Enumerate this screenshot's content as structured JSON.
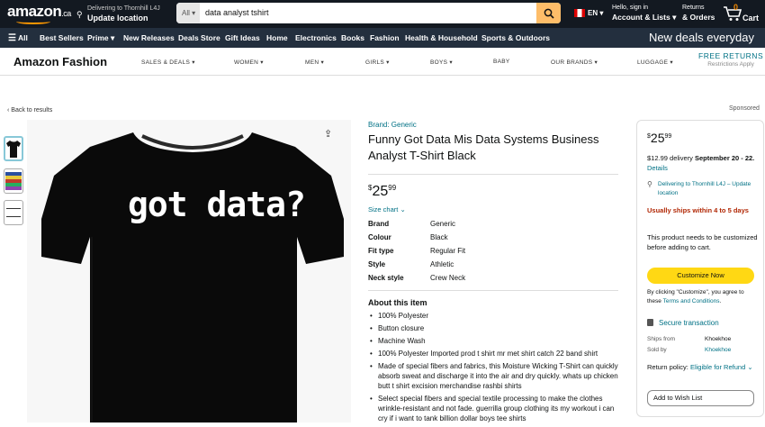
{
  "header": {
    "logo": "amazon",
    "logo_tld": ".ca",
    "deliver_line1": "Delivering to Thornhill L4J",
    "deliver_line2": "Update location",
    "search_category": "All",
    "search_value": "data analyst tshirt",
    "language": "EN",
    "account_line1": "Hello, sign in",
    "account_line2": "Account & Lists",
    "returns_line1": "Returns",
    "returns_line2": "& Orders",
    "cart_count": "0",
    "cart_label": "Cart"
  },
  "nav": {
    "all": "All",
    "items": [
      "Best Sellers",
      "Prime",
      "New Releases",
      "Deals Store",
      "Gift Ideas",
      "Home",
      "Electronics",
      "Books",
      "Fashion",
      "Health & Household",
      "Sports & Outdoors"
    ],
    "promo": "New deals everyday"
  },
  "fashion": {
    "title": "Amazon Fashion",
    "items": [
      "SALES & DEALS",
      "WOMEN",
      "MEN",
      "GIRLS",
      "BOYS",
      "BABY",
      "OUR BRANDS",
      "LUGGAGE"
    ],
    "free_returns": "FREE RETURNS",
    "free_returns_sub": "Restrictions Apply"
  },
  "breadcrumb": "Back to results",
  "sponsored": "Sponsored",
  "image_text": "got data?",
  "product": {
    "brand_link": "Brand: Generic",
    "title": "Funny Got Data Mis Data Systems Business Analyst T-Shirt Black",
    "price_symbol": "$",
    "price_whole": "25",
    "price_fraction": "99",
    "size_chart": "Size chart",
    "attributes": [
      {
        "k": "Brand",
        "v": "Generic"
      },
      {
        "k": "Colour",
        "v": "Black"
      },
      {
        "k": "Fit type",
        "v": "Regular Fit"
      },
      {
        "k": "Style",
        "v": "Athletic"
      },
      {
        "k": "Neck style",
        "v": "Crew Neck"
      }
    ],
    "about_title": "About this item",
    "bullets": [
      "100% Polyester",
      "Button closure",
      "Machine Wash",
      "100% Polyester Imported prod t shirt mr met shirt catch 22 band shirt",
      "Made of special fibers and fabrics, this Moisture Wicking T-Shirt can quickly absorb sweat and discharge it into the air and dry quickly. whats up chicken butt t shirt excision merchandise rashbi shirts",
      "Select special fibers and special textile processing to make the clothes wrinkle-resistant and not fade. guerrilla group clothing its my workout i can cry if i want to tank billion dollar boys tee shirts"
    ]
  },
  "buybox": {
    "price_symbol": "$",
    "price_whole": "25",
    "price_fraction": "99",
    "delivery_prefix": "$12.99 delivery",
    "delivery_date": "September 20 - 22.",
    "details": "Details",
    "location": "Delivering to Thornhill L4J – Update location",
    "ships": "Usually ships within 4 to 5 days",
    "note": "This product needs to be customized before adding to cart.",
    "customize": "Customize Now",
    "agree_prefix": "By clicking \"Customize\", you agree to these",
    "agree_link": "Terms and Conditions",
    "secure": "Secure transaction",
    "ships_from_label": "Ships from",
    "ships_from_value": "Khoekhoe",
    "sold_by_label": "Sold by",
    "sold_by_value": "Khoekhoe",
    "return_label": "Return policy:",
    "return_link": "Eligible for Refund",
    "wishlist": "Add to Wish List"
  }
}
